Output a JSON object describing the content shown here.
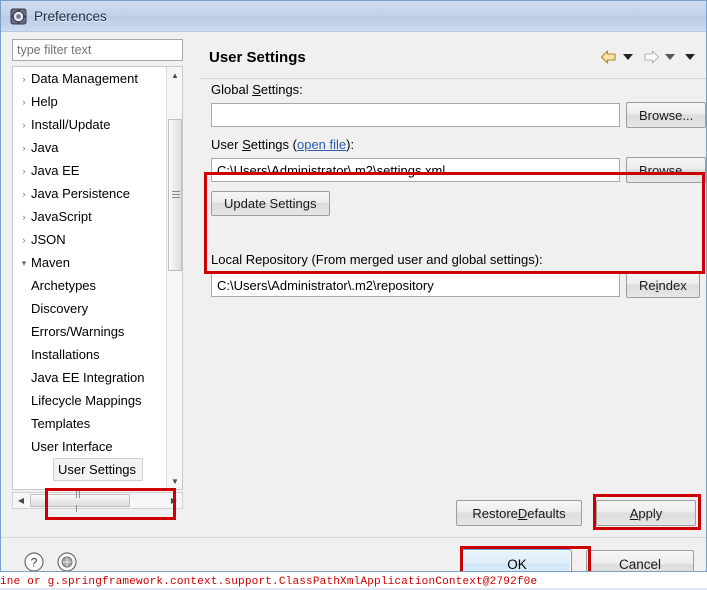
{
  "window": {
    "title": "Preferences",
    "icon": "preferences-gear-icon"
  },
  "backdrop": {
    "console_text": "ine or g.springframework.context.support.ClassPathXmlApplicationContext@2792f0e"
  },
  "sidebar": {
    "filter": {
      "placeholder": "type filter text",
      "value": ""
    },
    "items": [
      {
        "label": "Data Management",
        "level": 0,
        "expandable": true,
        "expanded": false,
        "selected": false
      },
      {
        "label": "Help",
        "level": 0,
        "expandable": true,
        "expanded": false,
        "selected": false
      },
      {
        "label": "Install/Update",
        "level": 0,
        "expandable": true,
        "expanded": false,
        "selected": false
      },
      {
        "label": "Java",
        "level": 0,
        "expandable": true,
        "expanded": false,
        "selected": false
      },
      {
        "label": "Java EE",
        "level": 0,
        "expandable": true,
        "expanded": false,
        "selected": false
      },
      {
        "label": "Java Persistence",
        "level": 0,
        "expandable": true,
        "expanded": false,
        "selected": false
      },
      {
        "label": "JavaScript",
        "level": 0,
        "expandable": true,
        "expanded": false,
        "selected": false
      },
      {
        "label": "JSON",
        "level": 0,
        "expandable": true,
        "expanded": false,
        "selected": false
      },
      {
        "label": "Maven",
        "level": 0,
        "expandable": true,
        "expanded": true,
        "selected": false
      },
      {
        "label": "Archetypes",
        "level": 1,
        "expandable": false,
        "expanded": false,
        "selected": false
      },
      {
        "label": "Discovery",
        "level": 1,
        "expandable": false,
        "expanded": false,
        "selected": false
      },
      {
        "label": "Errors/Warnings",
        "level": 1,
        "expandable": false,
        "expanded": false,
        "selected": false
      },
      {
        "label": "Installations",
        "level": 1,
        "expandable": false,
        "expanded": false,
        "selected": false
      },
      {
        "label": "Java EE Integration",
        "level": 1,
        "expandable": false,
        "expanded": false,
        "selected": false
      },
      {
        "label": "Lifecycle Mappings",
        "level": 1,
        "expandable": false,
        "expanded": false,
        "selected": false
      },
      {
        "label": "Templates",
        "level": 1,
        "expandable": false,
        "expanded": false,
        "selected": false
      },
      {
        "label": "User Interface",
        "level": 1,
        "expandable": false,
        "expanded": false,
        "selected": false
      },
      {
        "label": "User Settings",
        "level": 1,
        "expandable": false,
        "expanded": false,
        "selected": true
      }
    ]
  },
  "page": {
    "title": "User Settings",
    "nav": {
      "back_icon": "back-arrow-icon",
      "back_dropdown_icon": "chevron-down-icon",
      "forward_icon": "forward-arrow-icon",
      "forward_dropdown_icon": "chevron-down-icon",
      "menu_icon": "chevron-down-icon"
    },
    "global": {
      "label_pre": "Global ",
      "label_mnemonic": "S",
      "label_post": "ettings:",
      "value": "",
      "placeholder": "",
      "browse_label": "Browse..."
    },
    "user": {
      "label_pre": "User ",
      "label_mnemonic": "S",
      "label_mid": "ettings (",
      "link_label": "open file",
      "label_post": "):",
      "value": "C:\\Users\\Administrator\\.m2\\settings.xml",
      "placeholder": "",
      "browse_label": "Browse...",
      "update_label": "Update Settings"
    },
    "local": {
      "label": "Local Repository (From merged user and global settings):",
      "value": "C:\\Users\\Administrator\\.m2\\repository",
      "placeholder": "",
      "reindex_pre": "Re",
      "reindex_mnemonic": "i",
      "reindex_post": "ndex"
    },
    "restore_defaults": {
      "pre": "Restore ",
      "mnemonic": "D",
      "post": "efaults"
    },
    "apply": {
      "mnemonic": "A",
      "post": "pply"
    }
  },
  "footer": {
    "help_icon": "help-question-icon",
    "restore_icon": "restore-window-icon",
    "ok_label": "OK",
    "cancel_label": "Cancel"
  },
  "colors": {
    "annotation_red": "#cc0000",
    "link_blue": "#2a5db0",
    "titlebar_blue": "#c3d3e9",
    "ok_focus_border": "#4ea3d8"
  }
}
